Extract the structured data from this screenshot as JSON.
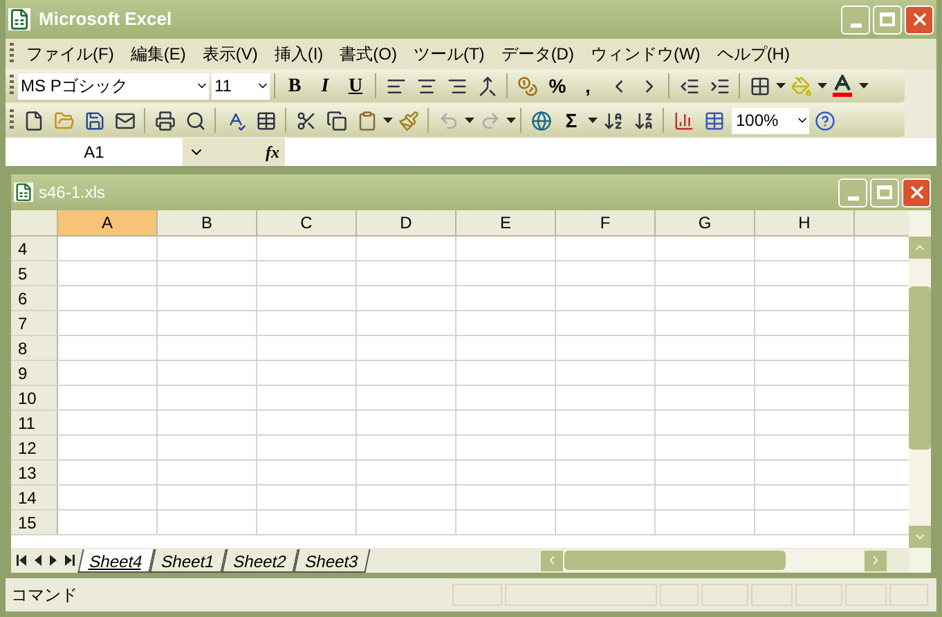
{
  "window": {
    "title": "Microsoft Excel"
  },
  "menu": [
    "ファイル(F)",
    "編集(E)",
    "表示(V)",
    "挿入(I)",
    "書式(O)",
    "ツール(T)",
    "データ(D)",
    "ウィンドウ(W)",
    "ヘルプ(H)"
  ],
  "formatting_toolbar": {
    "font_name": "MS Pゴシック",
    "font_size": "11",
    "bold": "B",
    "italic": "I",
    "underline": "U",
    "percent": "%",
    "comma": ","
  },
  "standard_toolbar": {
    "sum": "Σ",
    "zoom": "100%"
  },
  "formula_bar": {
    "name_box": "A1",
    "fx": "fx"
  },
  "workbook": {
    "title": "s46-1.xls",
    "columns": [
      {
        "label": "A",
        "selected": true
      },
      {
        "label": "B",
        "selected": false
      },
      {
        "label": "C",
        "selected": false
      },
      {
        "label": "D",
        "selected": false
      },
      {
        "label": "E",
        "selected": false
      },
      {
        "label": "F",
        "selected": false
      },
      {
        "label": "G",
        "selected": false
      },
      {
        "label": "H",
        "selected": false
      }
    ],
    "rows": [
      "4",
      "5",
      "6",
      "7",
      "8",
      "9",
      "10",
      "11",
      "12",
      "13",
      "14",
      "15"
    ],
    "sheet_tabs": [
      {
        "label": "Sheet4",
        "selected": true
      },
      {
        "label": "Sheet1",
        "selected": false
      },
      {
        "label": "Sheet2",
        "selected": false
      },
      {
        "label": "Sheet3",
        "selected": false
      }
    ]
  },
  "status_bar": {
    "text": "コマンド"
  }
}
